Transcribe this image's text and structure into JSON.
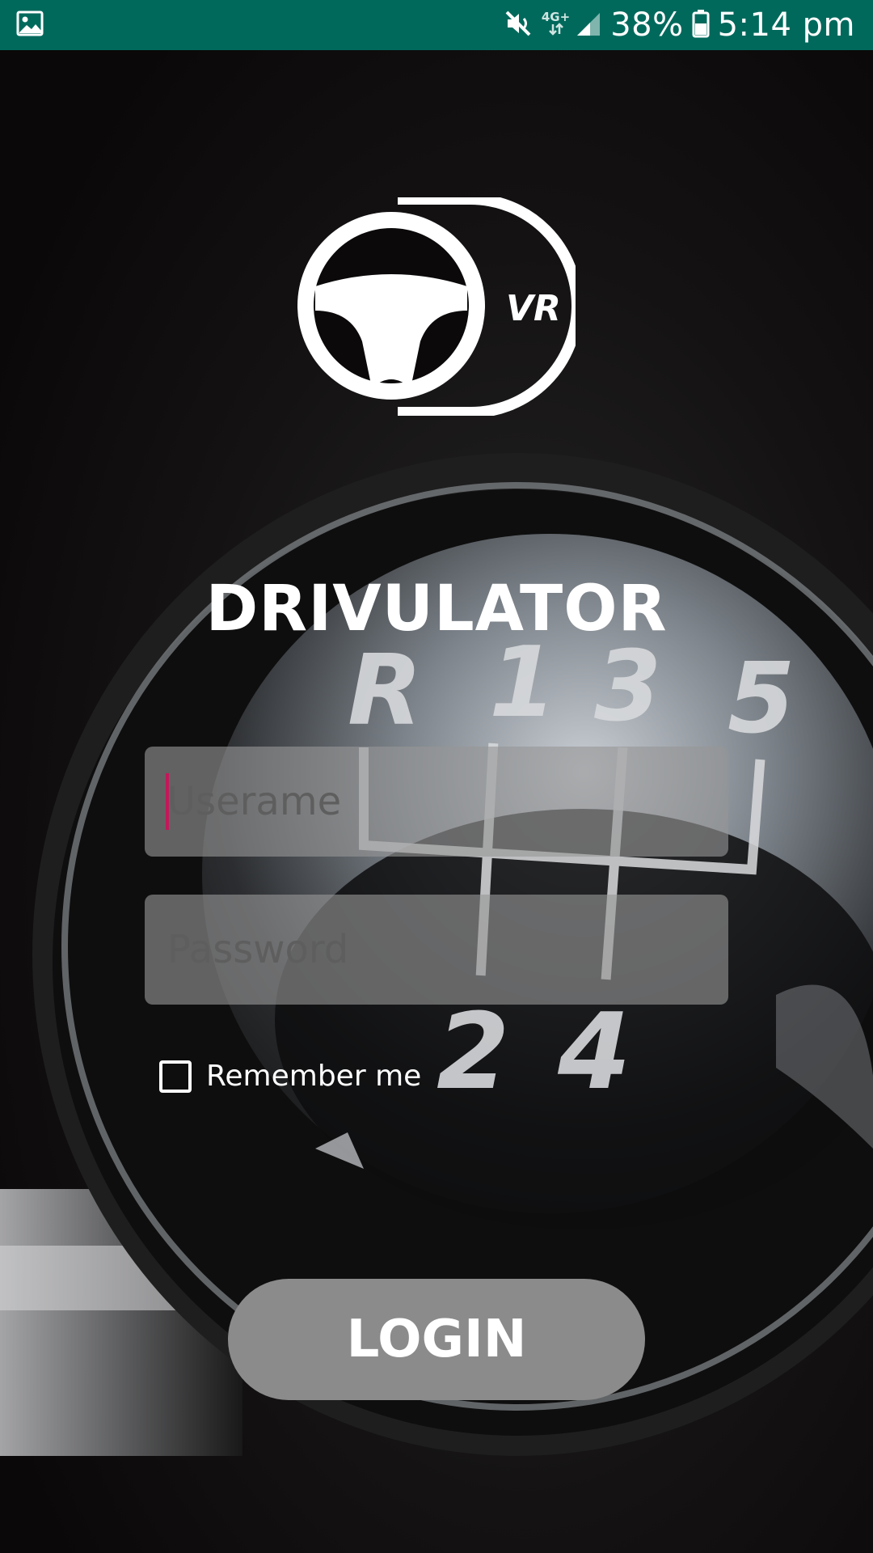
{
  "status_bar": {
    "gallery_icon": "image-icon",
    "mute_icon": "vibrate-off-icon",
    "network_type": "4G+",
    "signal_icon": "cell-signal-icon",
    "battery_percent": "38%",
    "battery_icon": "battery-icon",
    "time": "5:14 pm",
    "color": "#00695c"
  },
  "logo": {
    "icon": "steering-wheel-vr-logo",
    "vr_text": "VR"
  },
  "app_title": "DRIVULATOR",
  "login_form": {
    "username_placeholder": "Userame",
    "username_value": "",
    "password_placeholder": "Password",
    "password_value": "",
    "remember_label": "Remember me",
    "remember_checked": false,
    "login_label": "LOGIN"
  },
  "background": {
    "gear_labels": [
      "R",
      "1",
      "3",
      "5",
      "2",
      "4"
    ]
  },
  "colors": {
    "field_bg": "#969696",
    "button_bg": "#8b8b8b",
    "cursor": "#c2185b"
  }
}
